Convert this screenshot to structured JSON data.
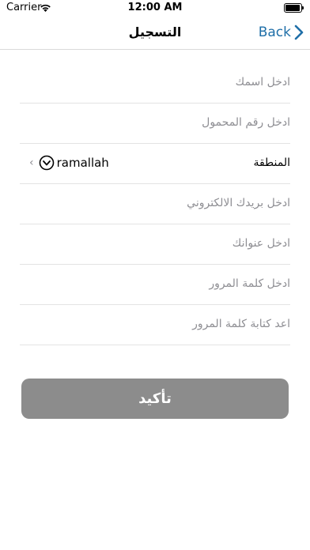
{
  "status_bar": {
    "carrier": "Carrier",
    "time": "12:00 AM"
  },
  "nav": {
    "title": "التسجيل",
    "back_label": "Back"
  },
  "form": {
    "name_placeholder": "ادخل اسمك",
    "mobile_placeholder": "ادخل رقم المحمول",
    "region_label": "المنطقة",
    "region_value": "ramallah",
    "email_placeholder": "ادخل بريدك الالكتروني",
    "address_placeholder": "ادخل عنوانك",
    "password_placeholder": "ادخل كلمة المرور",
    "confirm_password_placeholder": "اعد كتابة كلمة المرور"
  },
  "confirm_button": {
    "label": "تأكيد"
  },
  "colors": {
    "accent": "#1f6fa8",
    "button_bg": "#8c8c8c",
    "placeholder": "#8e8e93"
  }
}
